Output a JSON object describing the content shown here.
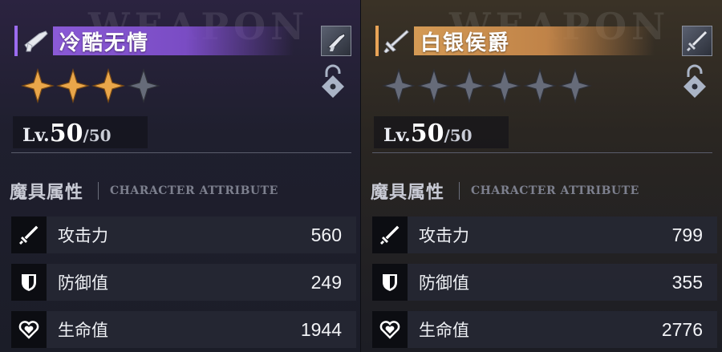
{
  "panels": [
    {
      "id": "left",
      "watermark": "WEAPON",
      "weapon_name": "冷酷无情",
      "weapon_icon": "gun-icon",
      "type_icon": "revolver-icon",
      "stars_filled": 3,
      "stars_total": 4,
      "lock_icon": "unlocked-padlock-icon",
      "level": {
        "prefix": "Lv.",
        "current": "50",
        "max": "/50"
      },
      "section": {
        "title_cn": "魔具属性",
        "title_en": "CHARACTER ATTRIBUTE"
      },
      "stats": [
        {
          "icon": "sword-icon",
          "label": "攻击力",
          "value": "560"
        },
        {
          "icon": "shield-icon",
          "label": "防御值",
          "value": "249"
        },
        {
          "icon": "heart-icon",
          "label": "生命值",
          "value": "1944"
        }
      ]
    },
    {
      "id": "right",
      "watermark": "WEAPON",
      "weapon_name": "白银侯爵",
      "weapon_icon": "sword-icon",
      "type_icon": "sword-icon",
      "stars_filled": 0,
      "stars_total": 6,
      "lock_icon": "unlocked-padlock-icon",
      "level": {
        "prefix": "Lv.",
        "current": "50",
        "max": "/50"
      },
      "section": {
        "title_cn": "魔具属性",
        "title_en": "CHARACTER ATTRIBUTE"
      },
      "stats": [
        {
          "icon": "sword-icon",
          "label": "攻击力",
          "value": "799"
        },
        {
          "icon": "shield-icon",
          "label": "防御值",
          "value": "355"
        },
        {
          "icon": "heart-icon",
          "label": "生命值",
          "value": "2776"
        }
      ]
    }
  ],
  "colors": {
    "star_gold": "#e9a64a",
    "star_empty": "#7c8190",
    "left_accent": "#8a5ad6",
    "right_accent": "#d49a55"
  }
}
